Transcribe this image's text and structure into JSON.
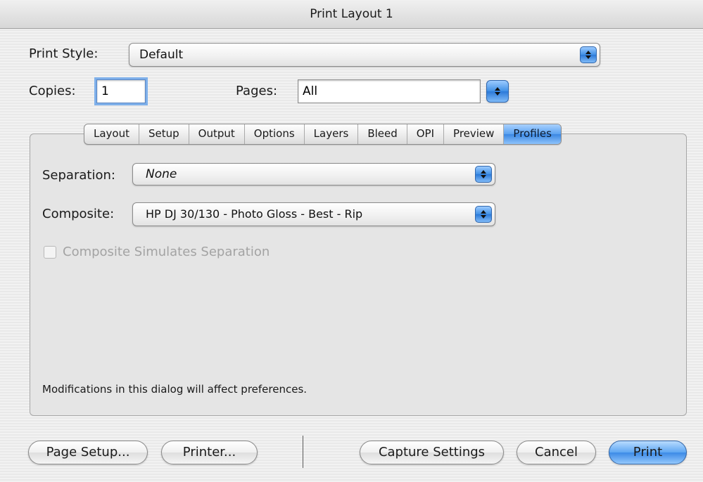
{
  "window": {
    "title": "Print Layout 1"
  },
  "print_style": {
    "label": "Print Style:",
    "value": "Default"
  },
  "copies": {
    "label": "Copies:",
    "value": "1"
  },
  "pages": {
    "label": "Pages:",
    "value": "All"
  },
  "tabs": [
    {
      "label": "Layout",
      "active": false
    },
    {
      "label": "Setup",
      "active": false
    },
    {
      "label": "Output",
      "active": false
    },
    {
      "label": "Options",
      "active": false
    },
    {
      "label": "Layers",
      "active": false
    },
    {
      "label": "Bleed",
      "active": false
    },
    {
      "label": "OPI",
      "active": false
    },
    {
      "label": "Preview",
      "active": false
    },
    {
      "label": "Profiles",
      "active": true
    }
  ],
  "profiles": {
    "separation": {
      "label": "Separation:",
      "value": "None"
    },
    "composite": {
      "label": "Composite:",
      "value": "HP DJ 30/130 - Photo Gloss - Best - Rip"
    },
    "composite_simulates_separation": {
      "label": "Composite Simulates Separation",
      "checked": false,
      "enabled": false
    }
  },
  "note": "Modifications in this dialog will affect preferences.",
  "buttons": {
    "page_setup": "Page Setup...",
    "printer": "Printer...",
    "capture_settings": "Capture Settings",
    "cancel": "Cancel",
    "print": "Print"
  },
  "colors": {
    "accent": "#3c8ae6",
    "disabled_text": "#a3a3a3"
  },
  "icons": {
    "popup_stepper": "up-down-arrows-icon"
  }
}
